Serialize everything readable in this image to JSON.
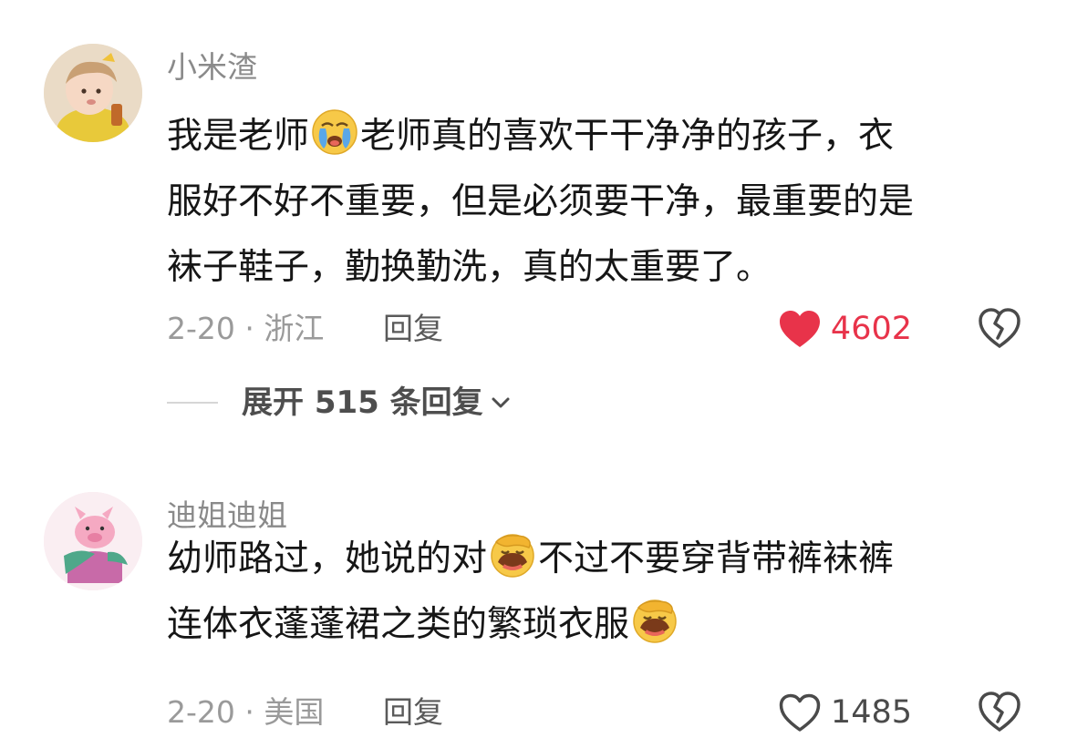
{
  "comments": [
    {
      "username": "小米渣",
      "lines": [
        "我是老师",
        "老师真的喜欢干干净净的孩子，衣",
        "服好不好不重要，但是必须要干净，最重要的是",
        "袜子鞋子，勤换勤洗，真的太重要了。"
      ],
      "date_location": "2-20 · 浙江",
      "reply_label": "回复",
      "likes": "4602",
      "liked": true,
      "expand_label": "展开 515 条回复",
      "emojis": [
        "crying-face-emoji"
      ]
    },
    {
      "username": "迪姐迪姐",
      "lines": [
        "幼师路过，她说的对",
        "不过不要穿背带裤袜裤",
        "连体衣蓬蓬裙之类的繁琐衣服"
      ],
      "date_location": "2-20 · 美国",
      "reply_label": "回复",
      "likes": "1485",
      "liked": false,
      "emojis": [
        "face-palm-laugh-emoji"
      ]
    }
  ],
  "colors": {
    "like_active": "#e8334a",
    "text_primary": "#161616",
    "text_secondary": "#8a8a8a"
  }
}
